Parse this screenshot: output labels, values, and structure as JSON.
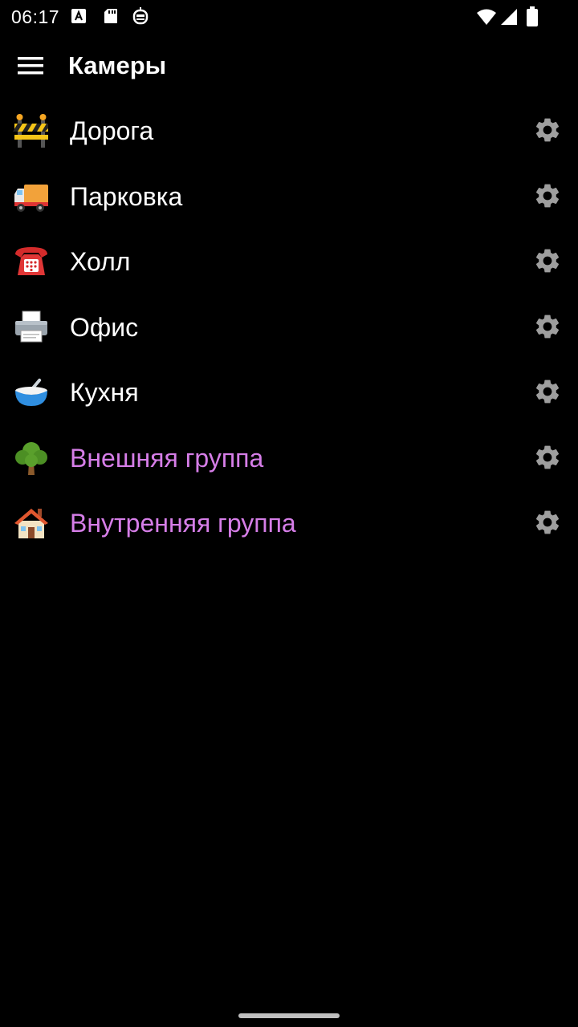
{
  "status_bar": {
    "time": "06:17",
    "icons": [
      "a-notification-icon",
      "sd-card-icon",
      "robot-icon",
      "wifi-icon",
      "signal-icon",
      "battery-icon"
    ]
  },
  "app_bar": {
    "title": "Камеры",
    "menu_icon": "hamburger-menu-icon"
  },
  "cameras": [
    {
      "emoji": "construction-barrier",
      "label": "Дорога",
      "kind": "camera"
    },
    {
      "emoji": "delivery-truck",
      "label": "Парковка",
      "kind": "camera"
    },
    {
      "emoji": "telephone",
      "label": "Холл",
      "kind": "camera"
    },
    {
      "emoji": "printer",
      "label": "Офис",
      "kind": "camera"
    },
    {
      "emoji": "bowl-with-spoon",
      "label": "Кухня",
      "kind": "camera"
    },
    {
      "emoji": "tree",
      "label": "Внешняя группа",
      "kind": "group"
    },
    {
      "emoji": "house",
      "label": "Внутренняя группа",
      "kind": "group"
    }
  ],
  "colors": {
    "background": "#000000",
    "camera_text": "#ffffff",
    "group_text": "#d67ee8",
    "gear_icon": "#9e9e9e"
  }
}
